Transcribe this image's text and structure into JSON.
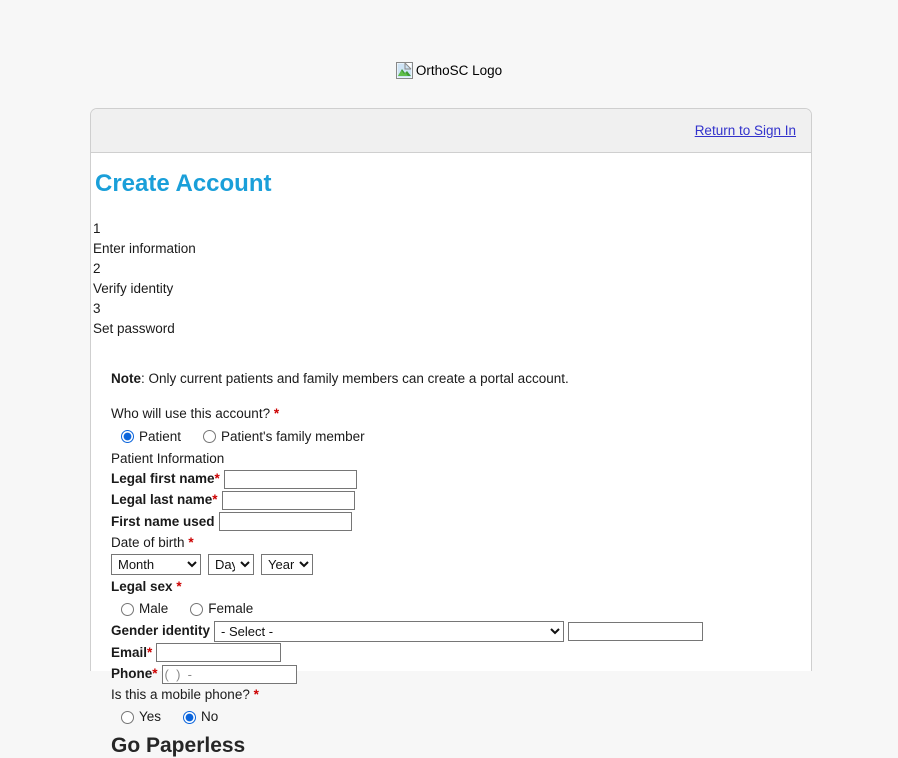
{
  "logo": {
    "alt_text": "OrthoSC Logo",
    "icon": "broken-image-icon"
  },
  "header": {
    "sign_in_link": "Return to Sign In"
  },
  "page": {
    "title": "Create Account",
    "paperless_heading": "Go Paperless"
  },
  "steps": [
    {
      "number": "1",
      "label": "Enter information"
    },
    {
      "number": "2",
      "label": "Verify identity"
    },
    {
      "number": "3",
      "label": "Set password"
    }
  ],
  "form": {
    "note_prefix": "Note",
    "note_sep": ": ",
    "note_text": "Only current patients and family members can create a portal account.",
    "who_question": "Who will use this account?",
    "who_options": [
      {
        "label": "Patient",
        "selected": true
      },
      {
        "label": "Patient's family member",
        "selected": false
      }
    ],
    "section_patient_info": "Patient Information",
    "legal_first_name_label": "Legal first name",
    "legal_first_name_value": "",
    "legal_last_name_label": "Legal last name",
    "legal_last_name_value": "",
    "first_name_used_label": "First name used",
    "first_name_used_value": "",
    "dob_label": "Date of birth",
    "dob_month": "Month",
    "dob_day": "Day",
    "dob_year": "Year",
    "legal_sex_label": "Legal sex",
    "legal_sex_options": [
      {
        "label": "Male",
        "selected": false
      },
      {
        "label": "Female",
        "selected": false
      }
    ],
    "gender_identity_label": "Gender identity",
    "gender_identity_value": "- Select -",
    "gender_identity_other_value": "",
    "email_label": "Email",
    "email_value": "",
    "phone_label": "Phone",
    "phone_value": "(  )  -",
    "mobile_question": "Is this a mobile phone?",
    "mobile_options": [
      {
        "label": "Yes",
        "selected": false
      },
      {
        "label": "No",
        "selected": true
      }
    ],
    "required_marker": "*"
  },
  "colors": {
    "title_blue": "#1a9fd9",
    "link_blue": "#3333cc",
    "required_red": "#cc0000",
    "panel_header_gray": "#f0f0f0",
    "page_bg": "#f7f7f7"
  }
}
